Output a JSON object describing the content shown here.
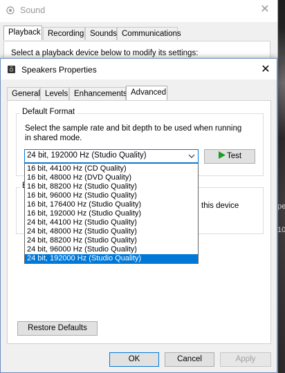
{
  "background_window": {
    "title": "Sound",
    "tabs": [
      "Playback",
      "Recording",
      "Sounds",
      "Communications"
    ],
    "active_tab": "Playback",
    "prompt": "Select a playback device below to modify its settings:",
    "close_glyph": "✕"
  },
  "background_fragments": [
    "pe",
    "10"
  ],
  "properties_window": {
    "title": "Speakers Properties",
    "close_glyph": "✕",
    "tabs": [
      "General",
      "Levels",
      "Enhancements",
      "Advanced"
    ],
    "active_tab": "Advanced",
    "default_format": {
      "legend": "Default Format",
      "description_line1": "Select the sample rate and bit depth to be used when running",
      "description_line2": "in shared mode.",
      "selected": "24 bit, 192000 Hz (Studio Quality)",
      "test_label": "Test",
      "options": [
        "16 bit, 44100 Hz (CD Quality)",
        "16 bit, 48000 Hz (DVD Quality)",
        "16 bit, 88200 Hz (Studio Quality)",
        "16 bit, 96000 Hz (Studio Quality)",
        "16 bit, 176400 Hz (Studio Quality)",
        "16 bit, 192000 Hz (Studio Quality)",
        "24 bit, 44100 Hz (Studio Quality)",
        "24 bit, 48000 Hz (Studio Quality)",
        "24 bit, 88200 Hz (Studio Quality)",
        "24 bit, 96000 Hz (Studio Quality)",
        "24 bit, 192000 Hz (Studio Quality)"
      ],
      "highlighted_option": "24 bit, 192000 Hz (Studio Quality)"
    },
    "exclusive_partial": {
      "legend_first_letter": "E",
      "text_fragment": "this device"
    },
    "restore_defaults_label": "Restore Defaults",
    "buttons": {
      "ok": "OK",
      "cancel": "Cancel",
      "apply": "Apply"
    }
  },
  "colors": {
    "accent": "#0078d7",
    "window_bg": "#f0f0f0",
    "panel_bg": "#ffffff",
    "test_play": "#1e9e1e"
  }
}
